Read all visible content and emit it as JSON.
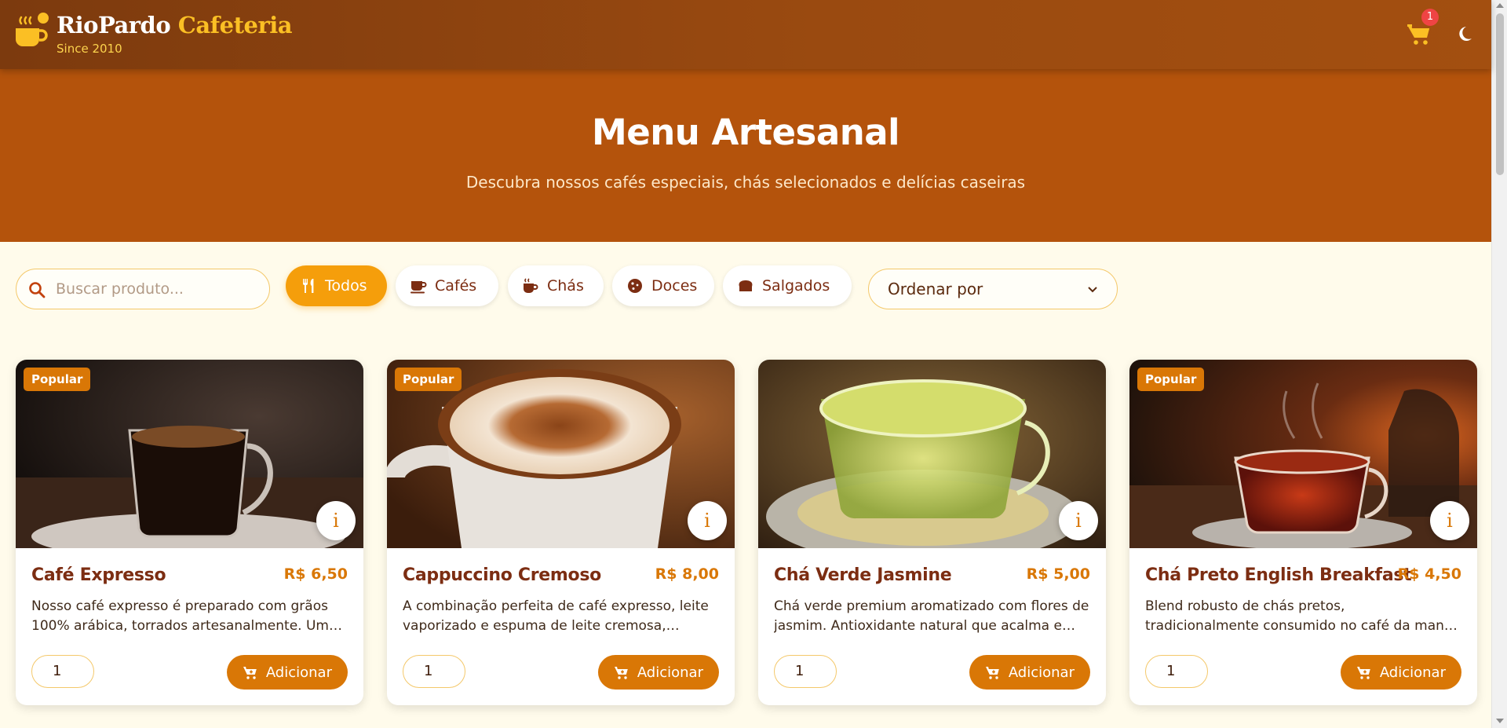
{
  "header": {
    "brand_first": "RioPardo",
    "brand_second": "Cafeteria",
    "since": "Since 2010",
    "cart_count": "1",
    "icons": {
      "logo": "coffee-mug-icon",
      "cart": "shopping-cart-icon",
      "theme": "moon-icon"
    }
  },
  "hero": {
    "title": "Menu Artesanal",
    "subtitle": "Descubra nossos cafés especiais, chás selecionados e delícias caseiras"
  },
  "filters": {
    "search_placeholder": "Buscar produto...",
    "chips": [
      {
        "label": "Todos",
        "icon": "utensils-icon",
        "active": true
      },
      {
        "label": "Cafés",
        "icon": "coffee-cup-icon",
        "active": false
      },
      {
        "label": "Chás",
        "icon": "mug-hot-icon",
        "active": false
      },
      {
        "label": "Doces",
        "icon": "cookie-icon",
        "active": false
      },
      {
        "label": "Salgados",
        "icon": "bread-icon",
        "active": false
      }
    ],
    "sort_label": "Ordenar por"
  },
  "products": [
    {
      "badge": "Popular",
      "name": "Café Expresso",
      "price": "R$ 6,50",
      "description": "Nosso café expresso é preparado com grãos 100% arábica, torrados artesanalmente. Um sabor intenso e encorpado.",
      "quantity": "1",
      "add_label": "Adicionar"
    },
    {
      "badge": "Popular",
      "name": "Cappuccino Cremoso",
      "price": "R$ 8,00",
      "description": "A combinação perfeita de café expresso, leite vaporizado e espuma de leite cremosa, finalizado com canela.",
      "quantity": "1",
      "add_label": "Adicionar"
    },
    {
      "badge": "",
      "name": "Chá Verde Jasmine",
      "price": "R$ 5,00",
      "description": "Chá verde premium aromatizado com flores de jasmim. Antioxidante natural que acalma e revigora.",
      "quantity": "1",
      "add_label": "Adicionar"
    },
    {
      "badge": "Popular",
      "name": "Chá Preto English Breakfast",
      "price": "R$ 4,50",
      "description": "Blend robusto de chás pretos, tradicionalmente consumido no café da manhã inglês.",
      "quantity": "1",
      "add_label": "Adicionar"
    }
  ],
  "colors": {
    "header": "#7c3a0e",
    "hero": "#b4530c",
    "accent": "#d97706",
    "active_chip": "#f59e0b",
    "page_bg": "#fffbeb",
    "brand_gold": "#fbbf24"
  }
}
